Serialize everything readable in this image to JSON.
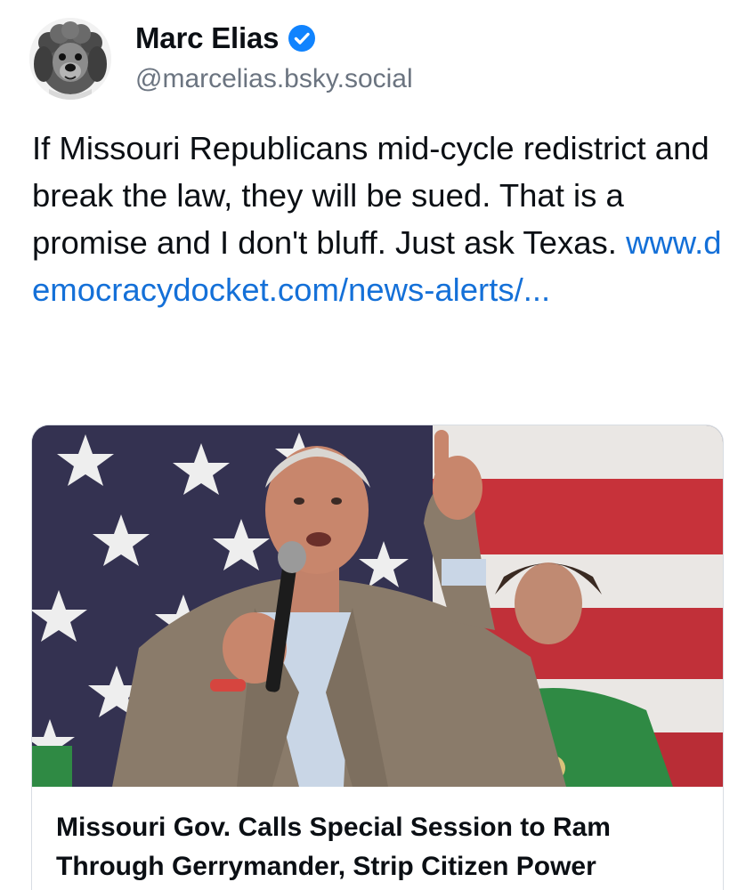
{
  "author": {
    "display_name": "Marc Elias",
    "handle": "@marcelias.bsky.social",
    "verified": true,
    "avatar_icon": "dog-avatar-icon",
    "verified_color": "#1083fe"
  },
  "post": {
    "text": "If Missouri Republicans mid-cycle redistrict and break the law, they will be sued. That is a promise and I don't bluff. Just ask Texas.",
    "link_text": "www.democracydocket.com/news-alerts/..."
  },
  "link_card": {
    "image_description_icon": "speaker-with-flag-photo",
    "title": "Missouri Gov. Calls Special Session to Ram Through Gerrymander, Strip Citizen Power"
  },
  "colors": {
    "link": "#1470d8",
    "handle": "#6b7480",
    "text": "#0b0f14"
  }
}
